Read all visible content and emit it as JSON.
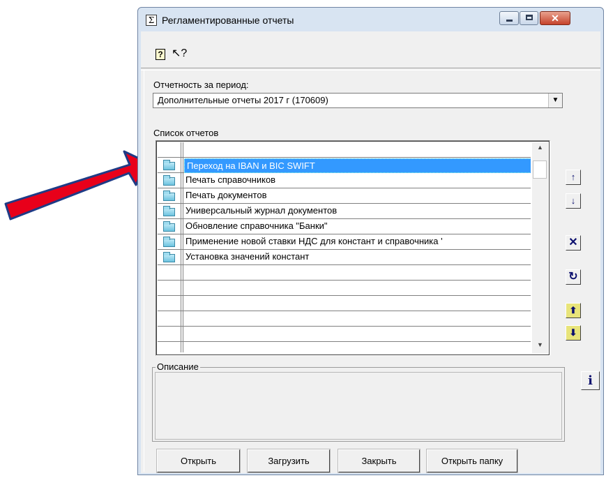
{
  "window": {
    "title": "Регламентированные отчеты",
    "close_glyph": "✕"
  },
  "toolbar": {
    "help_glyph": "?",
    "whats_this_glyph": "↖?"
  },
  "period": {
    "label": "Отчетность за период:",
    "selected": "Дополнительные отчеты 2017 г (170609)"
  },
  "reports": {
    "label": "Список отчетов",
    "items": [
      {
        "name": "Переход на IBAN и BIC SWIFT",
        "selected": true
      },
      {
        "name": "Печать справочников"
      },
      {
        "name": "Печать документов"
      },
      {
        "name": "Универсальный журнал документов"
      },
      {
        "name": "Обновление справочника \"Банки\""
      },
      {
        "name": "Применение новой ставки НДС для констант и справочника '"
      },
      {
        "name": "Установка значений констант"
      }
    ]
  },
  "side_buttons": {
    "up": "↑",
    "down": "↓",
    "delete": "✕",
    "refresh": "↻",
    "import": "⬆",
    "export": "⬇",
    "info": "i"
  },
  "description": {
    "label": "Описание"
  },
  "buttons": {
    "open": "Открыть",
    "load": "Загрузить",
    "close": "Закрыть",
    "open_folder": "Открыть папку"
  },
  "colors": {
    "selection": "#3399ff",
    "arrow": "#e8001a"
  }
}
